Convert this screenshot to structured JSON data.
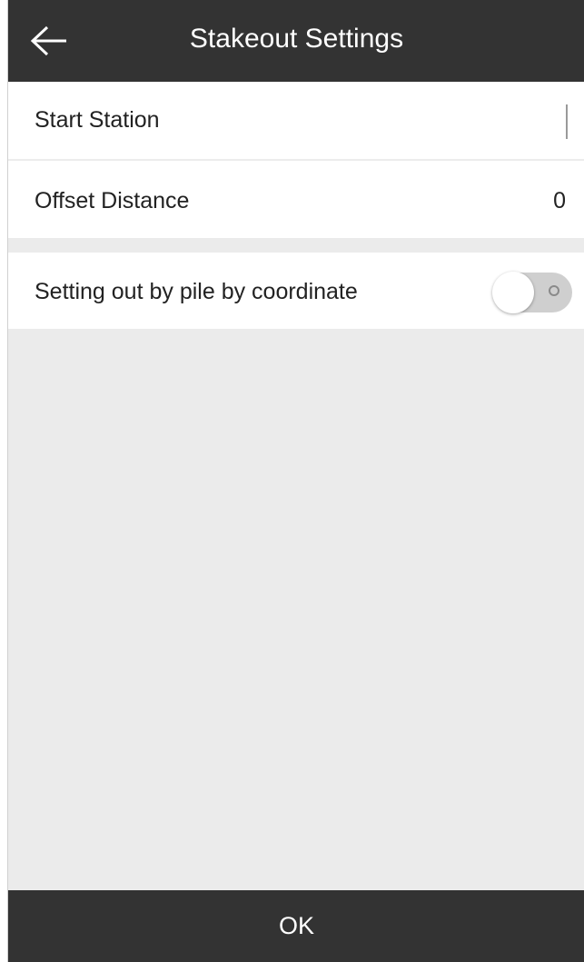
{
  "header": {
    "title": "Stakeout Settings",
    "back_icon": "arrow-left-icon"
  },
  "settings": {
    "start_station": {
      "label": "Start Station",
      "value": ""
    },
    "offset_distance": {
      "label": "Offset Distance",
      "value": "0"
    },
    "pile_by_coordinate": {
      "label": "Setting out by pile by coordinate",
      "enabled": false
    }
  },
  "footer": {
    "ok_label": "OK"
  },
  "colors": {
    "bar_background": "#333333",
    "content_background": "#ebebeb",
    "row_background": "#ffffff",
    "text": "#222222"
  }
}
